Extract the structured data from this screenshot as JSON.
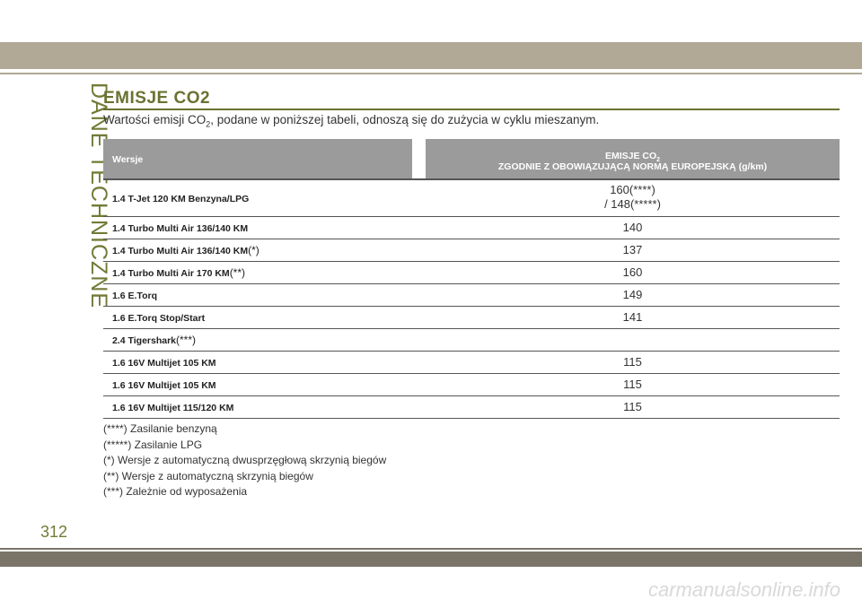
{
  "side_title": "DANE TECHNICZNE",
  "page_number": "312",
  "watermark": "carmanualsonline.info",
  "heading": "EMISJE CO2",
  "intro": {
    "before": "Wartości emisji CO",
    "sub": "2",
    "after": ", podane w poniższej tabeli, odnoszą się do zużycia w cyklu mieszanym."
  },
  "table": {
    "col_version": "Wersje",
    "col_emission_line1": "EMISJE CO",
    "col_emission_sub": "2",
    "col_emission_line2": "ZGODNIE Z OBOWIĄZUJĄCĄ NORMĄ EUROPEJSKĄ (g/km)",
    "rows": [
      {
        "version": "1.4 T-Jet 120 KM Benzyna/LPG",
        "mark": "",
        "value_line1": "160(****)",
        "value_line2": "/ 148(*****)"
      },
      {
        "version": "1.4 Turbo Multi Air 136/140 KM",
        "mark": "",
        "value": "140"
      },
      {
        "version": "1.4 Turbo Multi Air 136/140 KM",
        "mark": "(*)",
        "value": "137"
      },
      {
        "version": "1.4 Turbo Multi Air 170 KM",
        "mark": "(**)",
        "value": "160"
      },
      {
        "version": "1.6 E.Torq",
        "mark": "",
        "value": "149"
      },
      {
        "version": "1.6 E.Torq Stop/Start",
        "mark": "",
        "value": "141"
      },
      {
        "version": "2.4 Tigershark",
        "mark": "(***)",
        "value": ""
      },
      {
        "version": "1.6 16V Multijet 105 KM",
        "mark": "",
        "value": "115"
      },
      {
        "version": "1.6 16V Multijet 105 KM",
        "mark": "",
        "value": "115"
      },
      {
        "version": "1.6 16V Multijet 115/120 KM",
        "mark": "",
        "value": "115"
      }
    ]
  },
  "notes": [
    "(****) Zasilanie benzyną",
    "(*****) Zasilanie LPG",
    "(*) Wersje z automatyczną dwusprzęgłową skrzynią biegów",
    "(**) Wersje z automatyczną skrzynią biegów",
    "(***) Zależnie od wyposażenia"
  ]
}
